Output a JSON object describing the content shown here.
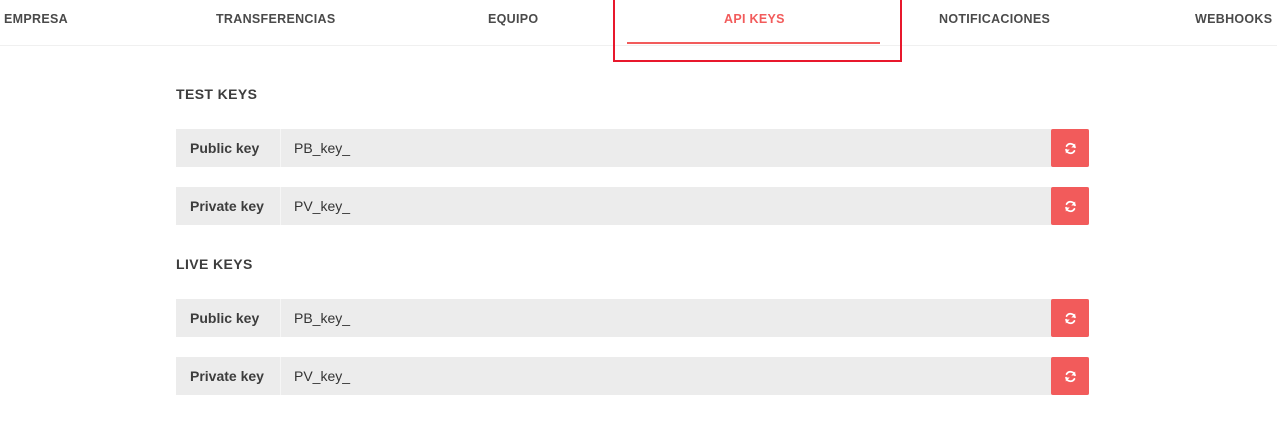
{
  "tabs": [
    {
      "label": "EMPRESA",
      "active": false
    },
    {
      "label": "TRANSFERENCIAS",
      "active": false
    },
    {
      "label": "EQUIPO",
      "active": false
    },
    {
      "label": "API KEYS",
      "active": true
    },
    {
      "label": "NOTIFICACIONES",
      "active": false
    },
    {
      "label": "WEBHOOKS",
      "active": false
    }
  ],
  "test_keys": {
    "title": "TEST KEYS",
    "public": {
      "label": "Public key",
      "value": "PB_key_",
      "icon": "refresh-icon"
    },
    "private": {
      "label": "Private key",
      "value": "PV_key_",
      "icon": "refresh-icon"
    }
  },
  "live_keys": {
    "title": "LIVE KEYS",
    "public": {
      "label": "Public key",
      "value": "PB_key_",
      "icon": "refresh-icon"
    },
    "private": {
      "label": "Private key",
      "value": "PV_key_",
      "icon": "refresh-icon"
    }
  },
  "colors": {
    "accent": "#f25b5b",
    "highlight_border": "#e8182c",
    "row_background": "#ececec"
  }
}
